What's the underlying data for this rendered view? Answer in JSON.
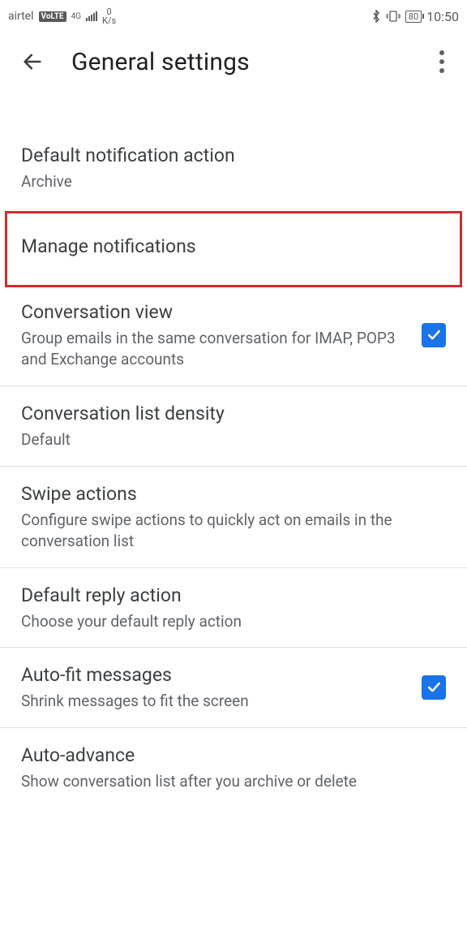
{
  "status": {
    "carrier": "airtel",
    "volte": "VoLTE",
    "network": "4G",
    "speed_top": "0",
    "speed_bottom": "K/s",
    "battery": "80",
    "time": "10:50"
  },
  "header": {
    "title": "General settings"
  },
  "items": {
    "default_notification": {
      "title": "Default notification action",
      "sub": "Archive"
    },
    "manage_notifications": {
      "title": "Manage notifications"
    },
    "conversation_view": {
      "title": "Conversation view",
      "sub": "Group emails in the same conversation for IMAP, POP3 and Exchange accounts",
      "checked": true
    },
    "list_density": {
      "title": "Conversation list density",
      "sub": "Default"
    },
    "swipe_actions": {
      "title": "Swipe actions",
      "sub": "Configure swipe actions to quickly act on emails in the conversation list"
    },
    "default_reply": {
      "title": "Default reply action",
      "sub": "Choose your default reply action"
    },
    "auto_fit": {
      "title": "Auto-fit messages",
      "sub": "Shrink messages to fit the screen",
      "checked": true
    },
    "auto_advance": {
      "title": "Auto-advance",
      "sub": "Show conversation list after you archive or delete"
    }
  }
}
